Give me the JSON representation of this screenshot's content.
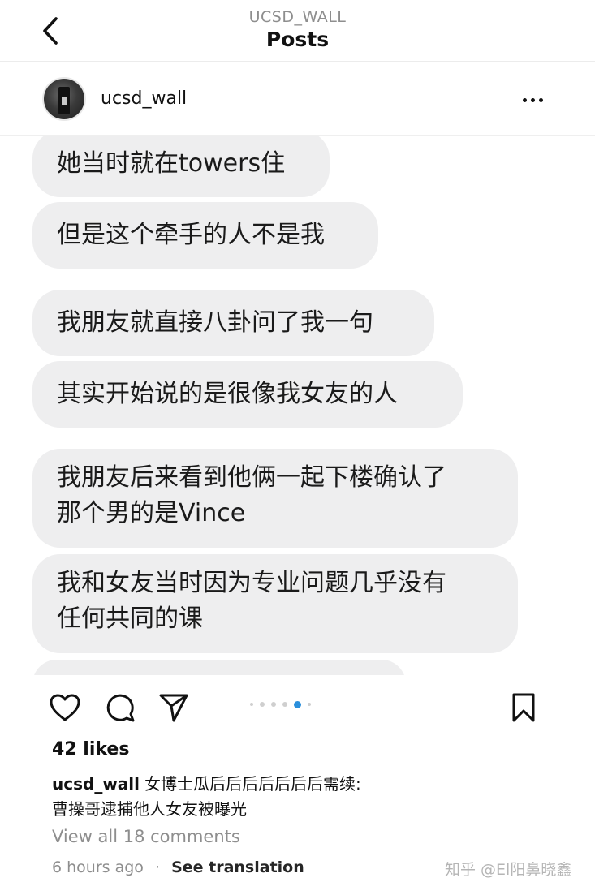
{
  "header": {
    "subtitle": "UCSD_WALL",
    "title": "Posts"
  },
  "post": {
    "username": "ucsd_wall",
    "messages": [
      "她当时就在towers住",
      "但是这个牵手的人不是我",
      "我朋友就直接八卦问了我一句",
      "其实开始说的是很像我女友的人",
      "我朋友后来看到他俩一起下楼确认了\n那个男的是Vince",
      "我和女友当时因为专业问题几乎没有\n任何共同的课"
    ],
    "carousel": {
      "total": 6,
      "active_index": 3
    },
    "likes": "42 likes",
    "caption_user": "ucsd_wall",
    "caption_text": "女博士瓜后后后后后后后需续:\n曹操哥逮捕他人女友被曝光",
    "view_comments": "View all 18 comments",
    "time_ago": "6 hours ago",
    "separator": "·",
    "see_translation": "See translation"
  },
  "icons": {
    "back": "chevron-left-icon",
    "more": "more-horizontal-icon",
    "like": "heart-icon",
    "comment": "comment-icon",
    "share": "send-icon",
    "save": "bookmark-icon"
  },
  "watermark": "知乎 @El阳鼻晓鑫"
}
